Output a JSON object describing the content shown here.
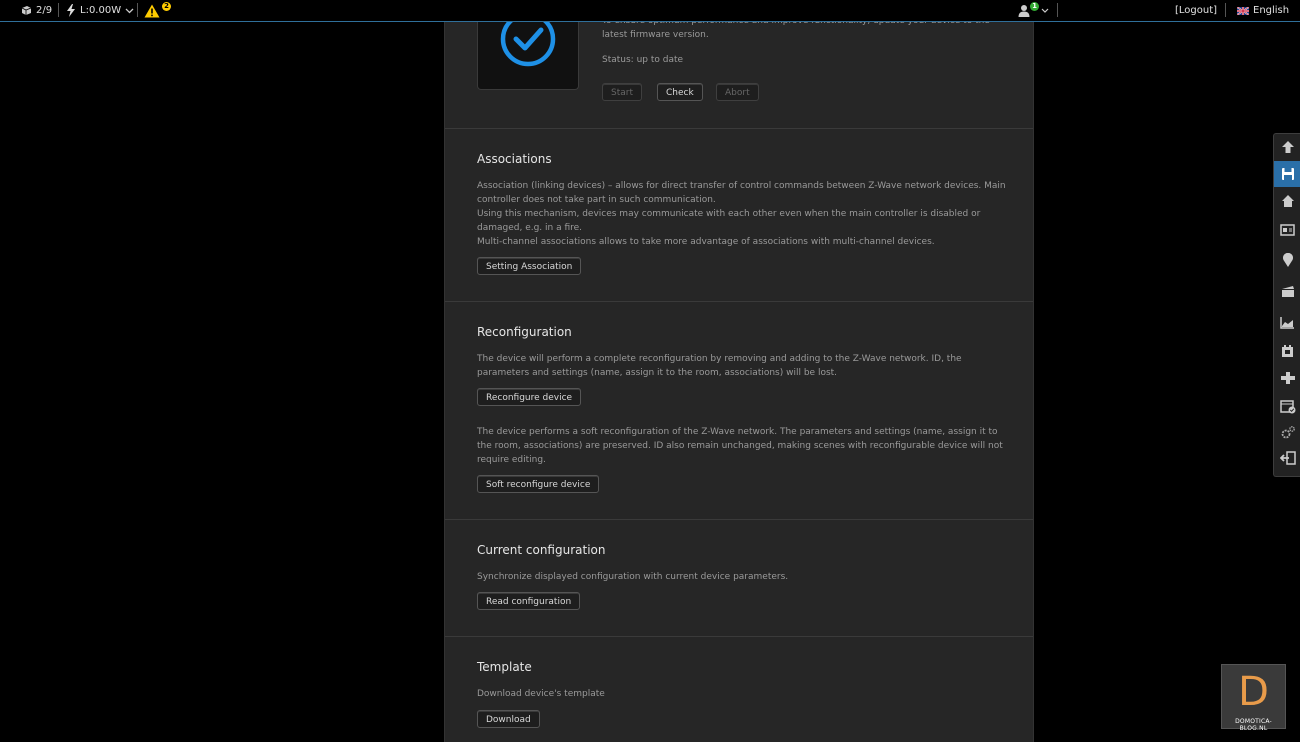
{
  "topbar": {
    "devices": "2/9",
    "power": "L:0.00W",
    "warnings": "2",
    "user_badge": "1",
    "logout": "[Logout]",
    "language": "English"
  },
  "firmware": {
    "description": "To ensure optimum performance and improve functionality, update your device to the latest firmware version.",
    "status": "Status: up to date",
    "start_label": "Start",
    "check_label": "Check",
    "abort_label": "Abort"
  },
  "associations": {
    "title": "Associations",
    "p1": "Association (linking devices) – allows for direct transfer of control commands between Z-Wave network devices. Main controller does not take part in such communication.",
    "p2": "Using this mechanism, devices may communicate with each other even when the main controller is disabled or damaged, e.g. in a fire.",
    "p3": "Multi-channel associations allows to take more advantage of associations with multi-channel devices.",
    "button": "Setting Association"
  },
  "reconfiguration": {
    "title": "Reconfiguration",
    "p1": "The device will perform a complete reconfiguration by removing and adding to the Z-Wave network. ID, the parameters and settings (name, assign it to the room, associations) will be lost.",
    "button1": "Reconfigure device",
    "p2": "The device performs a soft reconfiguration of the Z-Wave network. The parameters and settings (name, assign it to the room, associations) are preserved. ID also remain unchanged, making scenes with reconfigurable device will not require editing.",
    "button2": "Soft reconfigure device"
  },
  "current_configuration": {
    "title": "Current configuration",
    "text": "Synchronize displayed configuration with current device parameters.",
    "button": "Read configuration"
  },
  "template": {
    "title": "Template",
    "text": "Download device's template",
    "button": "Download"
  },
  "logo": {
    "letter": "D",
    "text": "DOMOTICA-BLOG.NL"
  },
  "colors": {
    "accent": "#2a8ee0",
    "panel": "#262626",
    "active_tool": "#2a6fa8"
  }
}
